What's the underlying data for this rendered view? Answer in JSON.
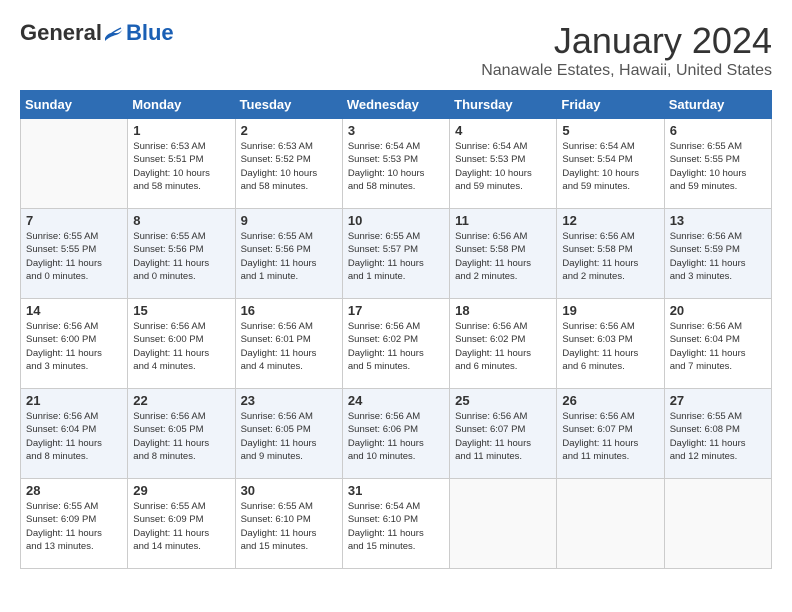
{
  "header": {
    "logo_general": "General",
    "logo_blue": "Blue",
    "month_title": "January 2024",
    "location": "Nanawale Estates, Hawaii, United States"
  },
  "days_of_week": [
    "Sunday",
    "Monday",
    "Tuesday",
    "Wednesday",
    "Thursday",
    "Friday",
    "Saturday"
  ],
  "weeks": [
    [
      {
        "day": "",
        "info": ""
      },
      {
        "day": "1",
        "info": "Sunrise: 6:53 AM\nSunset: 5:51 PM\nDaylight: 10 hours\nand 58 minutes."
      },
      {
        "day": "2",
        "info": "Sunrise: 6:53 AM\nSunset: 5:52 PM\nDaylight: 10 hours\nand 58 minutes."
      },
      {
        "day": "3",
        "info": "Sunrise: 6:54 AM\nSunset: 5:53 PM\nDaylight: 10 hours\nand 58 minutes."
      },
      {
        "day": "4",
        "info": "Sunrise: 6:54 AM\nSunset: 5:53 PM\nDaylight: 10 hours\nand 59 minutes."
      },
      {
        "day": "5",
        "info": "Sunrise: 6:54 AM\nSunset: 5:54 PM\nDaylight: 10 hours\nand 59 minutes."
      },
      {
        "day": "6",
        "info": "Sunrise: 6:55 AM\nSunset: 5:55 PM\nDaylight: 10 hours\nand 59 minutes."
      }
    ],
    [
      {
        "day": "7",
        "info": "Sunrise: 6:55 AM\nSunset: 5:55 PM\nDaylight: 11 hours\nand 0 minutes."
      },
      {
        "day": "8",
        "info": "Sunrise: 6:55 AM\nSunset: 5:56 PM\nDaylight: 11 hours\nand 0 minutes."
      },
      {
        "day": "9",
        "info": "Sunrise: 6:55 AM\nSunset: 5:56 PM\nDaylight: 11 hours\nand 1 minute."
      },
      {
        "day": "10",
        "info": "Sunrise: 6:55 AM\nSunset: 5:57 PM\nDaylight: 11 hours\nand 1 minute."
      },
      {
        "day": "11",
        "info": "Sunrise: 6:56 AM\nSunset: 5:58 PM\nDaylight: 11 hours\nand 2 minutes."
      },
      {
        "day": "12",
        "info": "Sunrise: 6:56 AM\nSunset: 5:58 PM\nDaylight: 11 hours\nand 2 minutes."
      },
      {
        "day": "13",
        "info": "Sunrise: 6:56 AM\nSunset: 5:59 PM\nDaylight: 11 hours\nand 3 minutes."
      }
    ],
    [
      {
        "day": "14",
        "info": "Sunrise: 6:56 AM\nSunset: 6:00 PM\nDaylight: 11 hours\nand 3 minutes."
      },
      {
        "day": "15",
        "info": "Sunrise: 6:56 AM\nSunset: 6:00 PM\nDaylight: 11 hours\nand 4 minutes."
      },
      {
        "day": "16",
        "info": "Sunrise: 6:56 AM\nSunset: 6:01 PM\nDaylight: 11 hours\nand 4 minutes."
      },
      {
        "day": "17",
        "info": "Sunrise: 6:56 AM\nSunset: 6:02 PM\nDaylight: 11 hours\nand 5 minutes."
      },
      {
        "day": "18",
        "info": "Sunrise: 6:56 AM\nSunset: 6:02 PM\nDaylight: 11 hours\nand 6 minutes."
      },
      {
        "day": "19",
        "info": "Sunrise: 6:56 AM\nSunset: 6:03 PM\nDaylight: 11 hours\nand 6 minutes."
      },
      {
        "day": "20",
        "info": "Sunrise: 6:56 AM\nSunset: 6:04 PM\nDaylight: 11 hours\nand 7 minutes."
      }
    ],
    [
      {
        "day": "21",
        "info": "Sunrise: 6:56 AM\nSunset: 6:04 PM\nDaylight: 11 hours\nand 8 minutes."
      },
      {
        "day": "22",
        "info": "Sunrise: 6:56 AM\nSunset: 6:05 PM\nDaylight: 11 hours\nand 8 minutes."
      },
      {
        "day": "23",
        "info": "Sunrise: 6:56 AM\nSunset: 6:05 PM\nDaylight: 11 hours\nand 9 minutes."
      },
      {
        "day": "24",
        "info": "Sunrise: 6:56 AM\nSunset: 6:06 PM\nDaylight: 11 hours\nand 10 minutes."
      },
      {
        "day": "25",
        "info": "Sunrise: 6:56 AM\nSunset: 6:07 PM\nDaylight: 11 hours\nand 11 minutes."
      },
      {
        "day": "26",
        "info": "Sunrise: 6:56 AM\nSunset: 6:07 PM\nDaylight: 11 hours\nand 11 minutes."
      },
      {
        "day": "27",
        "info": "Sunrise: 6:55 AM\nSunset: 6:08 PM\nDaylight: 11 hours\nand 12 minutes."
      }
    ],
    [
      {
        "day": "28",
        "info": "Sunrise: 6:55 AM\nSunset: 6:09 PM\nDaylight: 11 hours\nand 13 minutes."
      },
      {
        "day": "29",
        "info": "Sunrise: 6:55 AM\nSunset: 6:09 PM\nDaylight: 11 hours\nand 14 minutes."
      },
      {
        "day": "30",
        "info": "Sunrise: 6:55 AM\nSunset: 6:10 PM\nDaylight: 11 hours\nand 15 minutes."
      },
      {
        "day": "31",
        "info": "Sunrise: 6:54 AM\nSunset: 6:10 PM\nDaylight: 11 hours\nand 15 minutes."
      },
      {
        "day": "",
        "info": ""
      },
      {
        "day": "",
        "info": ""
      },
      {
        "day": "",
        "info": ""
      }
    ]
  ]
}
